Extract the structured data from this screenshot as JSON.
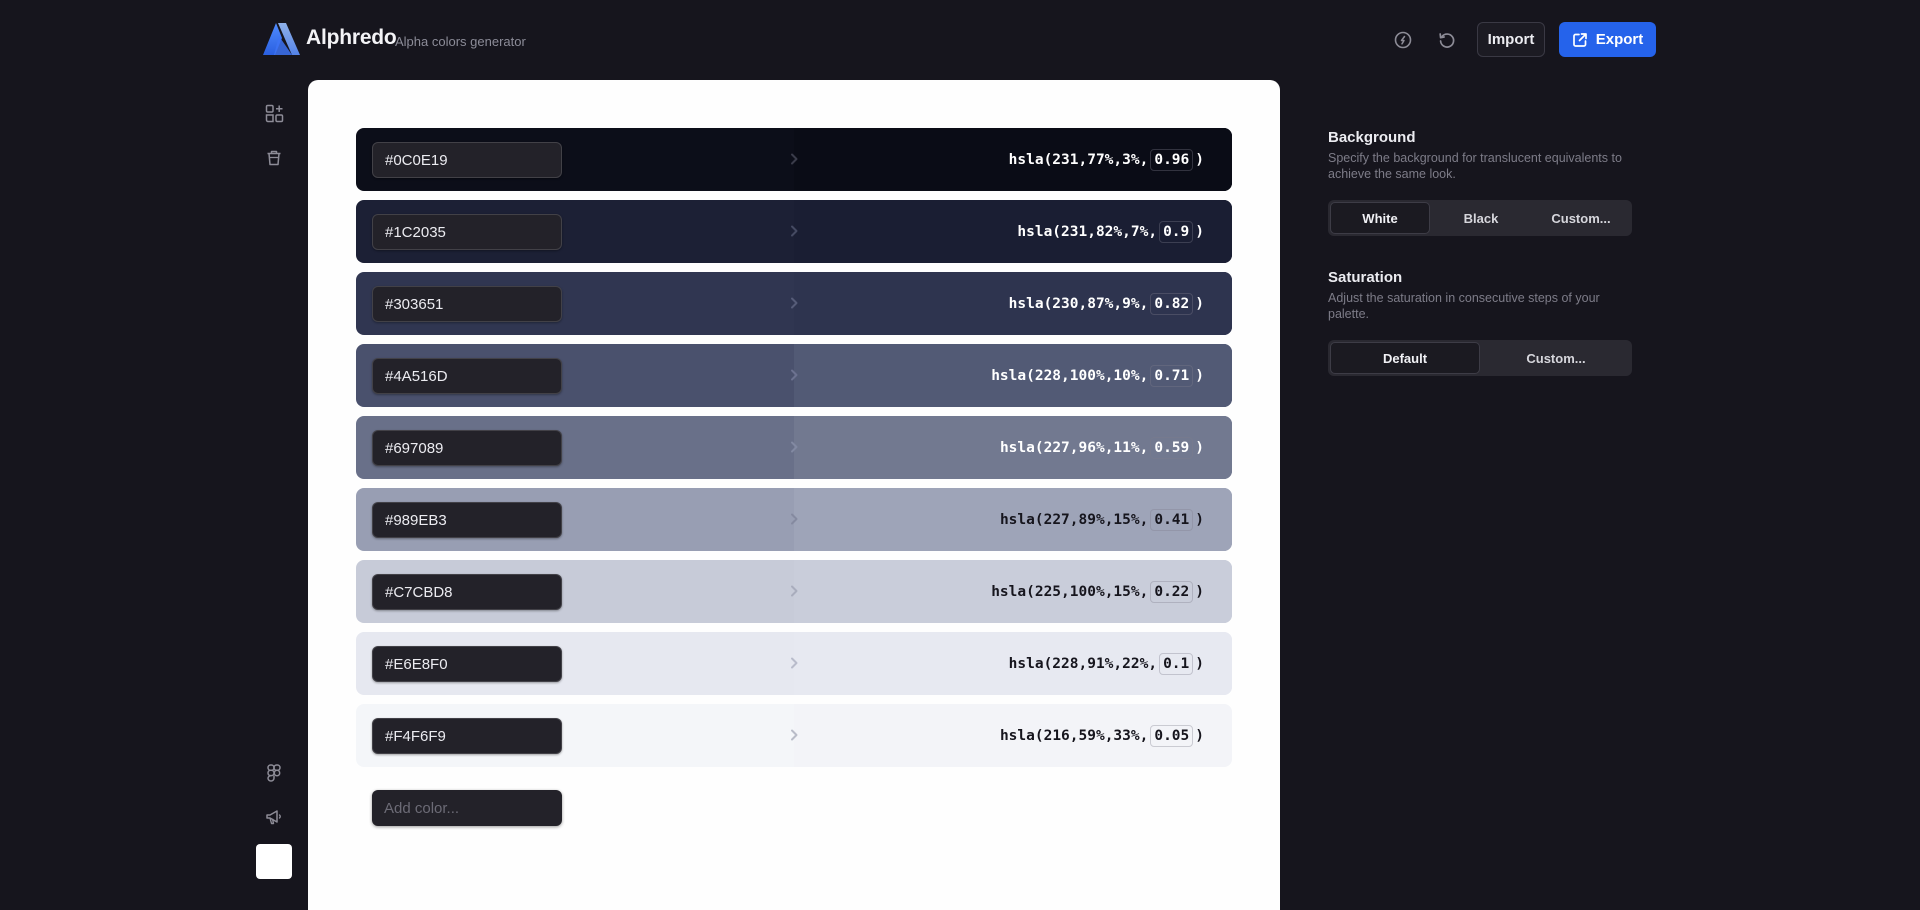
{
  "app": {
    "name": "Alphredo",
    "tagline": "Alpha colors generator"
  },
  "header": {
    "import_label": "Import",
    "export_label": "Export",
    "icons": [
      "tip-coin-icon",
      "reset-icon",
      "export-share-icon"
    ]
  },
  "rail": {
    "icons": [
      "palette-components-icon",
      "trash-icon",
      "figma-icon",
      "megaphone-icon"
    ],
    "swatch_color": "#FFFFFF"
  },
  "colors": [
    {
      "hex": "#0C0E19",
      "hsla_prefix": "hsla(231,77%,3%,",
      "alpha": "0.96",
      "suffix": ")",
      "bg": "#0C0E19",
      "bg_right": "#0a0c16",
      "text": "#ffffff",
      "arrow": "#3a3c4a"
    },
    {
      "hex": "#1C2035",
      "hsla_prefix": "hsla(231,82%,7%,",
      "alpha": "0.9",
      "suffix": ")",
      "bg": "#1C2035",
      "bg_right": "#1a1e33",
      "text": "#ffffff",
      "arrow": "#454a62"
    },
    {
      "hex": "#303651",
      "hsla_prefix": "hsla(230,87%,9%,",
      "alpha": "0.82",
      "suffix": ")",
      "bg": "#303651",
      "bg_right": "#2e344f",
      "text": "#ffffff",
      "arrow": "#565c78"
    },
    {
      "hex": "#4A516D",
      "hsla_prefix": "hsla(228,100%,10%,",
      "alpha": "0.71",
      "suffix": ")",
      "bg": "#4A516D",
      "bg_right": "#525a75",
      "text": "#ffffff",
      "arrow": "#6c7290"
    },
    {
      "hex": "#697089",
      "hsla_prefix": "hsla(227,96%,11%,",
      "alpha": "0.59",
      "suffix": ")",
      "bg": "#697089",
      "bg_right": "#727990",
      "text": "#ffffff",
      "arrow": "#8289a2"
    },
    {
      "hex": "#989EB3",
      "hsla_prefix": "hsla(227,89%,15%,",
      "alpha": "0.41",
      "suffix": ")",
      "bg": "#989EB3",
      "bg_right": "#9ea4b8",
      "text": "#16151d",
      "arrow": "#858aa0"
    },
    {
      "hex": "#C7CBD8",
      "hsla_prefix": "hsla(225,100%,15%,",
      "alpha": "0.22",
      "suffix": ")",
      "bg": "#C7CBD8",
      "bg_right": "#c9cdda",
      "text": "#16151d",
      "arrow": "#a9adbd"
    },
    {
      "hex": "#E6E8F0",
      "hsla_prefix": "hsla(228,91%,22%,",
      "alpha": "0.1",
      "suffix": ")",
      "bg": "#E6E8F0",
      "bg_right": "#e7e9f1",
      "text": "#16151d",
      "arrow": "#b9bccb"
    },
    {
      "hex": "#F4F6F9",
      "hsla_prefix": "hsla(216,59%,33%,",
      "alpha": "0.05",
      "suffix": ")",
      "bg": "#F4F6F9",
      "bg_right": "#f3f4f8",
      "text": "#16151d",
      "arrow": "#b9bcc8"
    }
  ],
  "add_color": {
    "placeholder": "Add color..."
  },
  "background": {
    "title": "Background",
    "description": "Specify the background for translucent equivalents to achieve the same look.",
    "options": [
      "White",
      "Black",
      "Custom..."
    ],
    "selected": "White"
  },
  "saturation": {
    "title": "Saturation",
    "description": "Adjust the saturation in consecutive steps of your palette.",
    "options": [
      "Default",
      "Custom..."
    ],
    "selected": "Default"
  }
}
